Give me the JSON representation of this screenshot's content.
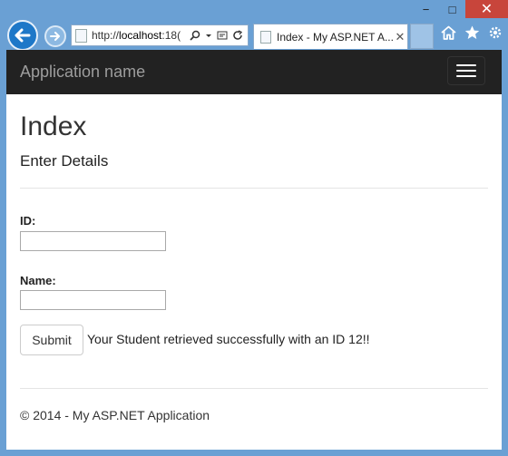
{
  "window": {
    "minimize_glyph": "−",
    "maximize_glyph": "□",
    "close_glyph": "✕"
  },
  "browser": {
    "address_prefix": "http://",
    "address_host": "localhost",
    "address_rest": ":18(",
    "tab_title": "Index - My ASP.NET A...",
    "tab_close_glyph": "✕",
    "icons": [
      "back-arrow-icon",
      "forward-arrow-icon",
      "search-icon",
      "dropdown-icon",
      "compat-view-icon",
      "refresh-icon",
      "home-icon",
      "favorites-star-icon",
      "settings-gear-icon"
    ],
    "accent": "#1e78c8"
  },
  "navbar": {
    "brand": "Application name"
  },
  "page": {
    "title": "Index",
    "subtitle": "Enter Details",
    "id_label": "ID:",
    "id_value": "",
    "name_label": "Name:",
    "name_value": "",
    "submit_label": "Submit",
    "message": "Your Student retrieved successfully with an ID 12!!",
    "footer": "© 2014 - My ASP.NET Application"
  }
}
